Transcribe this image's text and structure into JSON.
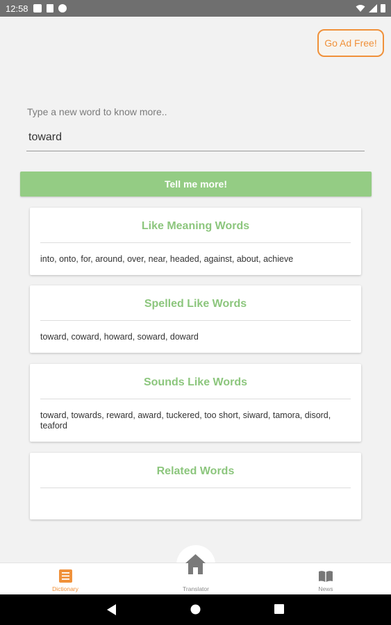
{
  "status_bar": {
    "time": "12:58"
  },
  "header": {
    "ad_free_label": "Go Ad Free!"
  },
  "search": {
    "label": "Type a new word to know more..",
    "value": "toward"
  },
  "action": {
    "tell_me_more_label": "Tell me more!"
  },
  "sections": [
    {
      "title": "Like Meaning Words",
      "content": "into, onto, for, around, over, near, headed, against, about, achieve"
    },
    {
      "title": "Spelled Like Words",
      "content": "toward, coward, howard, soward, doward"
    },
    {
      "title": "Sounds Like Words",
      "content": "toward, towards, reward, award, tuckered, too short, siward, tamora, disord, teaford"
    },
    {
      "title": "Related Words",
      "content": ""
    }
  ],
  "bottom_nav": {
    "items": [
      {
        "label": "Dictionary",
        "icon": "list-icon",
        "active": true
      },
      {
        "label": "Translator",
        "icon": "home-icon",
        "active": false
      },
      {
        "label": "News",
        "icon": "book-icon",
        "active": false
      }
    ]
  },
  "colors": {
    "accent_green": "#8cc67d",
    "button_green": "#94cc84",
    "accent_orange": "#f0913a"
  }
}
